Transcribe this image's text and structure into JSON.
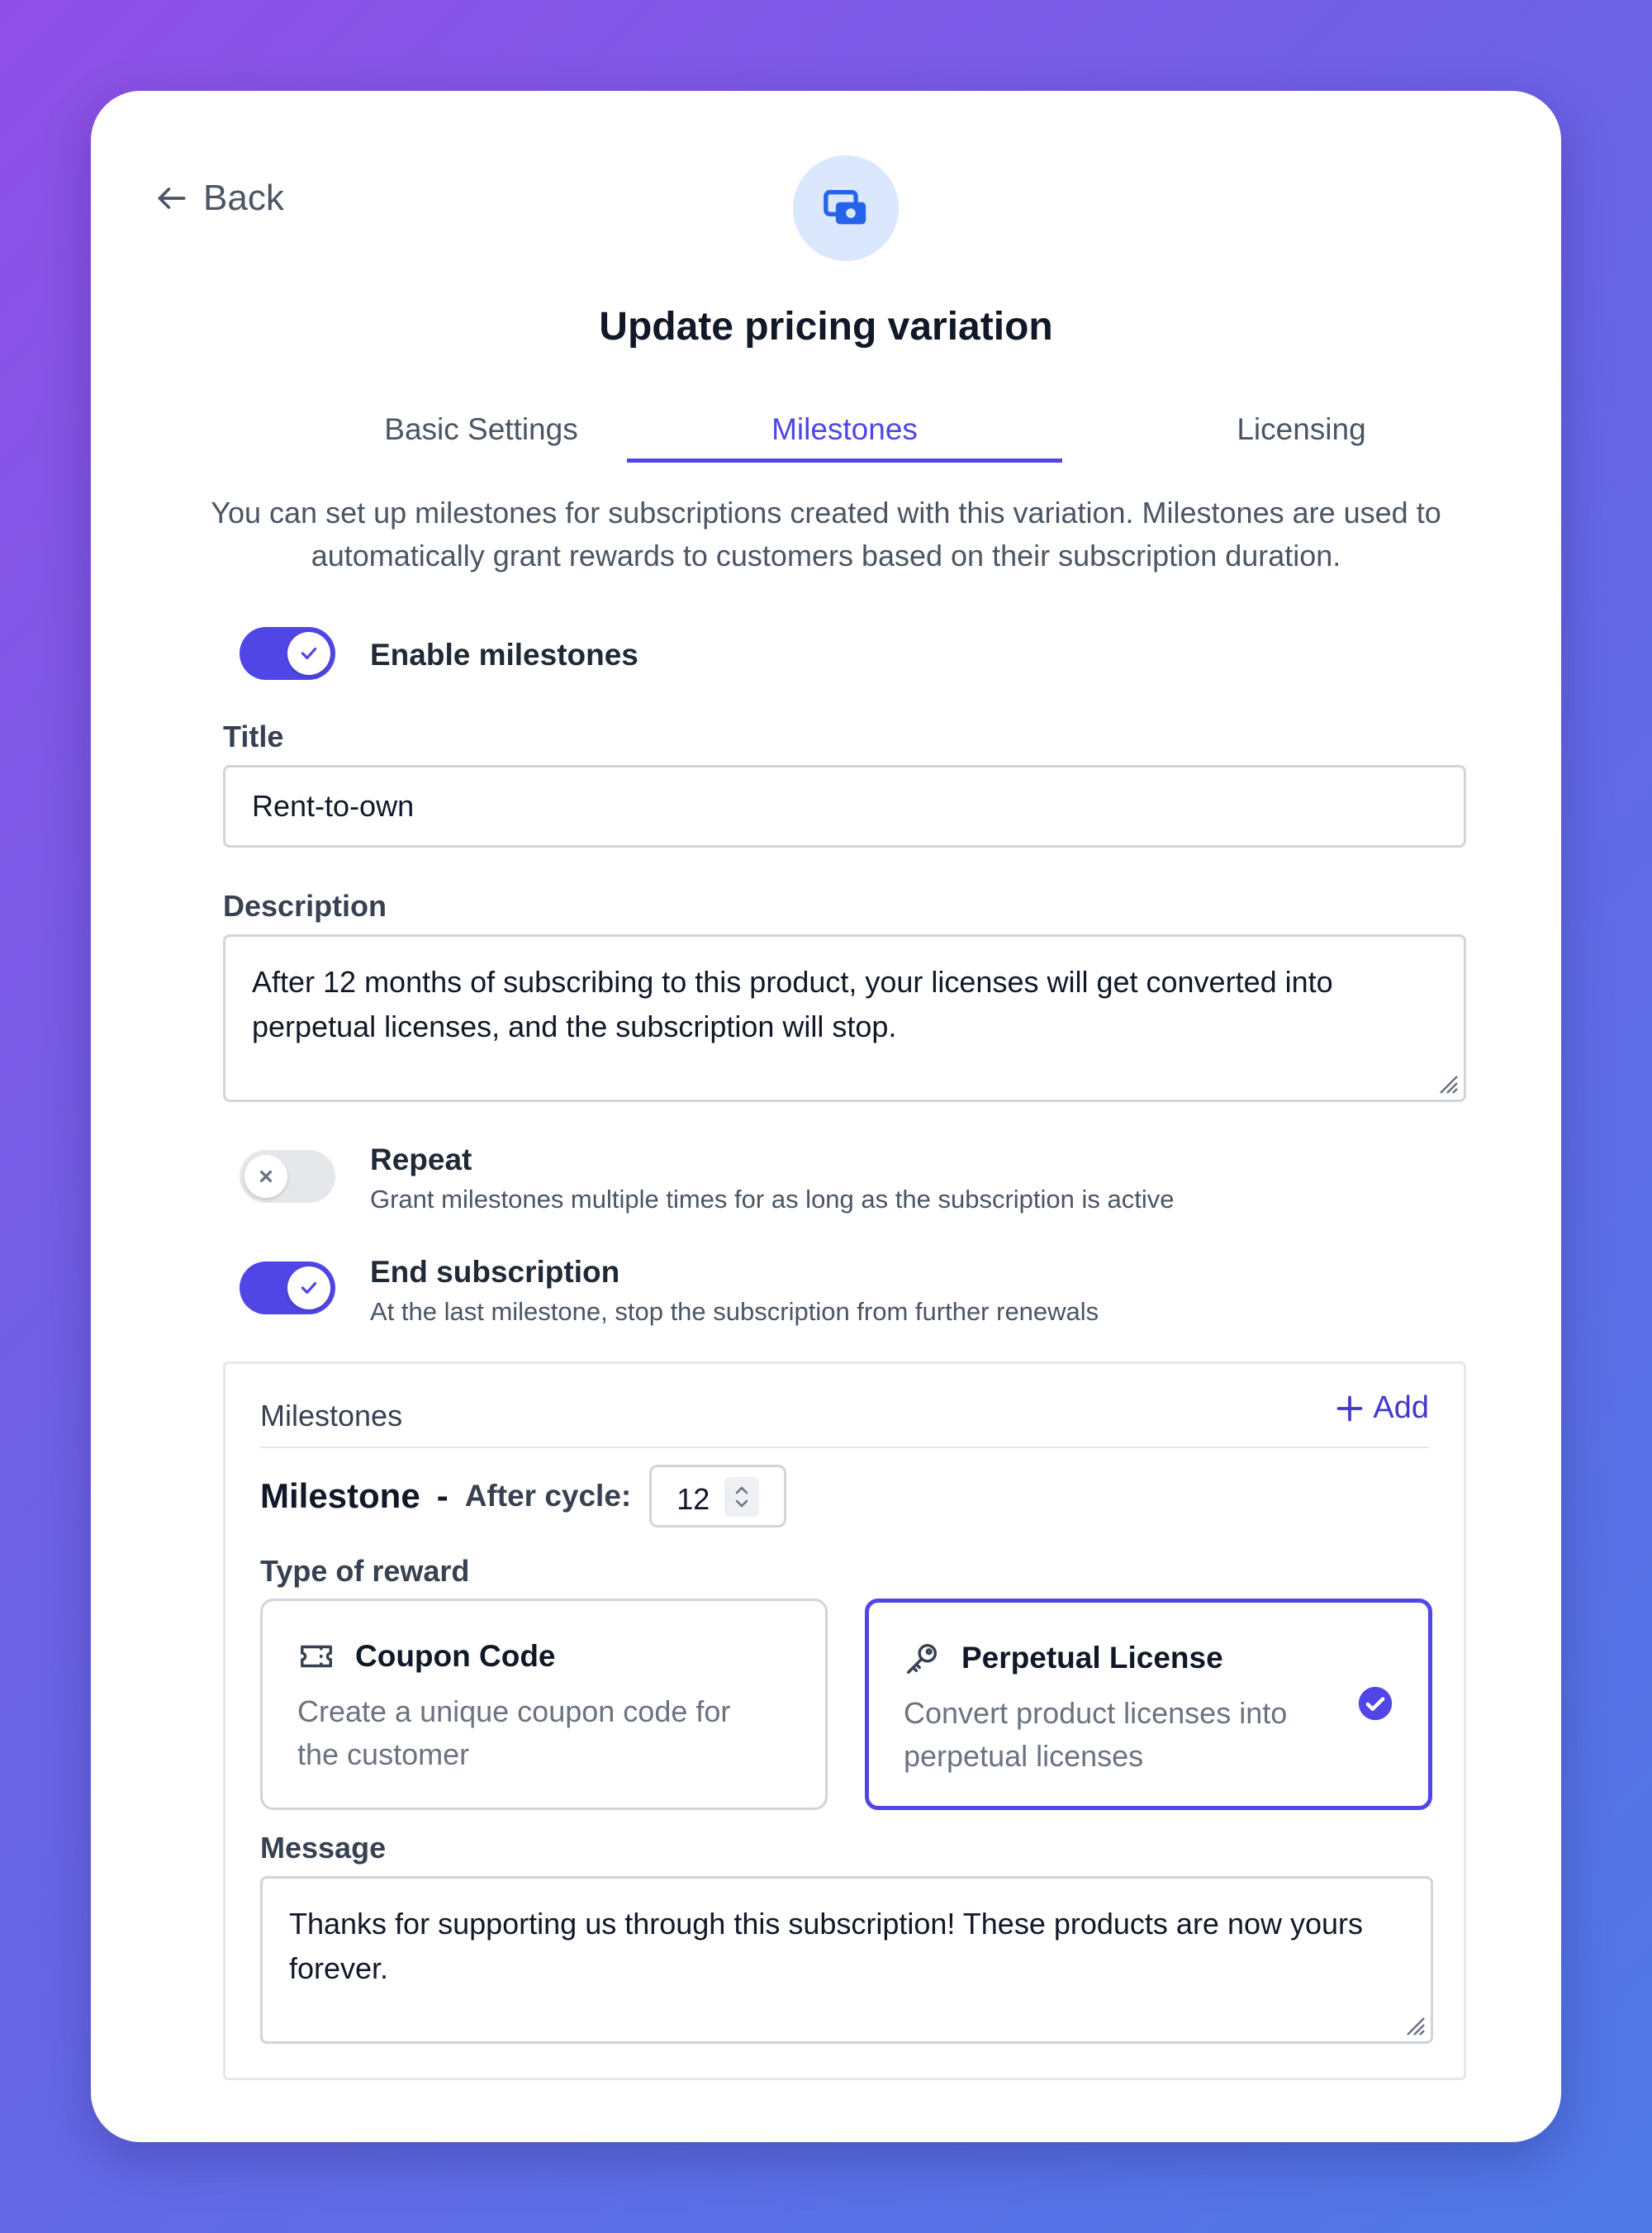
{
  "header": {
    "back_label": "Back",
    "title": "Update pricing variation"
  },
  "tabs": [
    {
      "label": "Basic Settings",
      "active": false
    },
    {
      "label": "Milestones",
      "active": true
    },
    {
      "label": "Licensing",
      "active": false
    }
  ],
  "intro_text": "You can set up milestones for subscriptions created with this variation. Milestones are used to automatically grant rewards to customers based on their subscription duration.",
  "enable_milestones": {
    "label": "Enable milestones",
    "enabled": true
  },
  "title_field": {
    "label": "Title",
    "value": "Rent-to-own"
  },
  "description_field": {
    "label": "Description",
    "value": "After 12 months of subscribing to this product, your licenses will get converted into perpetual licenses, and the subscription will stop."
  },
  "repeat": {
    "label": "Repeat",
    "description": "Grant milestones multiple times for as long as the subscription is active",
    "enabled": false
  },
  "end_subscription": {
    "label": "End subscription",
    "description": "At the last milestone, stop the subscription from further renewals",
    "enabled": true
  },
  "milestones": {
    "heading": "Milestones",
    "add_label": "Add",
    "items": [
      {
        "title": "Milestone",
        "separator": "-",
        "after_cycle_label": "After cycle:",
        "after_cycle_value": "12",
        "reward_label": "Type of reward",
        "reward_options": [
          {
            "icon": "ticket-icon",
            "title": "Coupon Code",
            "description": "Create a unique coupon code for the customer",
            "selected": false
          },
          {
            "icon": "key-icon",
            "title": "Perpetual License",
            "description": "Convert product licenses into perpetual licenses",
            "selected": true
          }
        ],
        "message_label": "Message",
        "message_value": "Thanks for supporting us through this subscription! These products are now yours forever."
      }
    ]
  },
  "colors": {
    "accent": "#4f46e5",
    "icon_circle_bg": "#dbe7fd",
    "icon_blue": "#2563eb"
  }
}
